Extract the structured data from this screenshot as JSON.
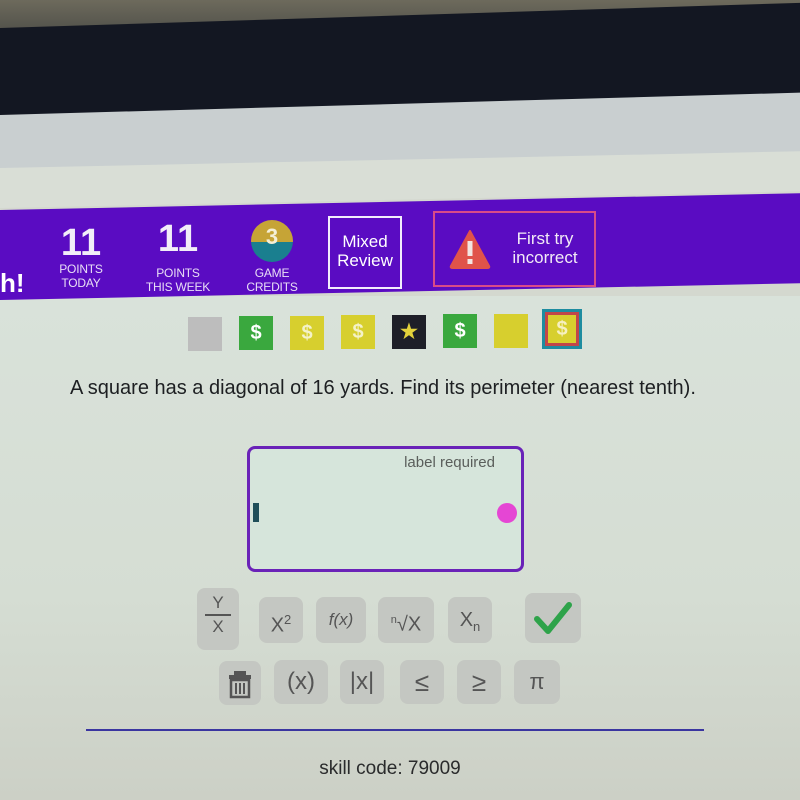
{
  "header": {
    "brand_fragment": "h!",
    "points_today": {
      "value": "11",
      "label_line1": "POINTS",
      "label_line2": "TODAY"
    },
    "points_week": {
      "value": "11",
      "label_line1": "POINTS",
      "label_line2": "THIS WEEK"
    },
    "game_credits": {
      "value": "3",
      "label_line1": "GAME",
      "label_line2": "CREDITS"
    },
    "mixed_review": {
      "line1": "Mixed",
      "line2": "Review"
    },
    "first_try": {
      "line1": "First try",
      "line2": "incorrect",
      "icon": "warning-icon"
    },
    "colors": {
      "bar": "#5a0cc2",
      "warning": "#e0534a",
      "first_try_border": "#d94b88"
    }
  },
  "progress": {
    "tiles": [
      {
        "state": "gray",
        "symbol": ""
      },
      {
        "state": "green",
        "symbol": "$"
      },
      {
        "state": "yellow",
        "symbol": "$"
      },
      {
        "state": "yellow",
        "symbol": "$"
      },
      {
        "state": "dark",
        "symbol": "★"
      },
      {
        "state": "green",
        "symbol": "$"
      },
      {
        "state": "yellow",
        "symbol": ""
      },
      {
        "state": "current",
        "symbol": "$"
      }
    ]
  },
  "question": {
    "text": "A square has a diagonal of 16 yards. Find its perimeter (nearest tenth)."
  },
  "answer": {
    "value": "",
    "hint": "label required"
  },
  "keypad": {
    "row1": [
      {
        "name": "fraction",
        "num": "Y",
        "den": "X"
      },
      {
        "name": "square",
        "base": "X",
        "sup": "2"
      },
      {
        "name": "function",
        "label": "f(x)"
      },
      {
        "name": "nth-root",
        "idx": "n",
        "label": "√X"
      },
      {
        "name": "subscript",
        "base": "X",
        "sub": "n"
      },
      {
        "name": "submit",
        "label": "✓"
      }
    ],
    "row2": [
      {
        "name": "trash",
        "label": ""
      },
      {
        "name": "parentheses",
        "label": "(x)"
      },
      {
        "name": "absolute-value",
        "label": "|x|"
      },
      {
        "name": "less-equal",
        "label": "≤"
      },
      {
        "name": "greater-equal",
        "label": "≥"
      },
      {
        "name": "pi",
        "label": "π"
      }
    ]
  },
  "footer": {
    "skill_code": "skill code: 79009"
  }
}
